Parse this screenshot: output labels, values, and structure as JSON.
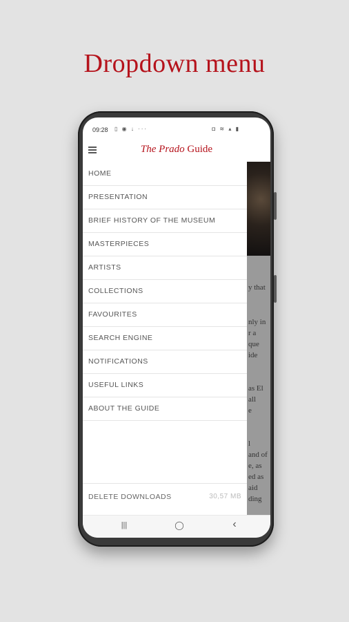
{
  "headline": "Dropdown menu",
  "status_bar": {
    "time": "09:28",
    "left_icons": "▯ ◉ ↓ ···",
    "right_icons": "◘ ≋ ▴ ▮"
  },
  "app_bar": {
    "brand_italic": "The Prado",
    "brand_regular": " Guide"
  },
  "menu": {
    "items": [
      {
        "label": "HOME"
      },
      {
        "label": "PRESENTATION"
      },
      {
        "label": "BRIEF HISTORY OF THE MUSEUM"
      },
      {
        "label": "MASTERPIECES"
      },
      {
        "label": "ARTISTS"
      },
      {
        "label": "COLLECTIONS"
      },
      {
        "label": "FAVOURITES"
      },
      {
        "label": "SEARCH ENGINE"
      },
      {
        "label": "NOTIFICATIONS"
      },
      {
        "label": "USEFUL LINKS"
      },
      {
        "label": "ABOUT THE GUIDE"
      }
    ],
    "delete_downloads": {
      "label": "DELETE DOWNLOADS",
      "size": "30,57 MB"
    }
  },
  "background_text": [
    "y that",
    "nly in",
    "r a",
    "que",
    "ide",
    "as El",
    "all",
    "e",
    "l",
    "and of",
    "e, as",
    "ed as",
    "aid",
    "ding"
  ],
  "nav_bar": {
    "recents": "|||",
    "home": "◯",
    "back": "‹"
  },
  "colors": {
    "brand_red": "#b5121b",
    "background": "#e3e3e3"
  }
}
